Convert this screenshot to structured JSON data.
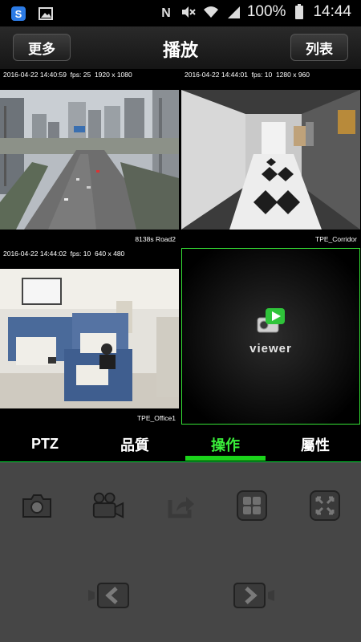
{
  "status_bar": {
    "battery_percent": "100%",
    "time": "14:44"
  },
  "nav": {
    "left_button": "更多",
    "title": "播放",
    "right_button": "列表"
  },
  "cameras": [
    {
      "timestamp": "2016-04-22 14:40:59",
      "fps": "fps: 25",
      "resolution": "1920 x 1080",
      "name": "8138s Road2"
    },
    {
      "timestamp": "2016-04-22 14:44:01",
      "fps": "fps: 10",
      "resolution": "1280 x 960",
      "name": "TPE_Corridor"
    },
    {
      "timestamp": "2016-04-22 14:44:02",
      "fps": "fps: 10",
      "resolution": "640 x 480",
      "name": "TPE_Office1"
    }
  ],
  "viewer_logo_text": "viewer",
  "tabs": [
    "PTZ",
    "品質",
    "操作",
    "屬性"
  ],
  "active_tab_index": 2,
  "controls": {
    "row1": [
      "snapshot-icon",
      "record-icon",
      "share-icon",
      "layout-icon",
      "fullscreen-icon"
    ],
    "row2": [
      "previous-camera-icon",
      "next-camera-icon"
    ]
  },
  "colors": {
    "accent": "#1bd41b",
    "panel_bg": "#464646",
    "nav_bg": "#1e1e1e"
  }
}
